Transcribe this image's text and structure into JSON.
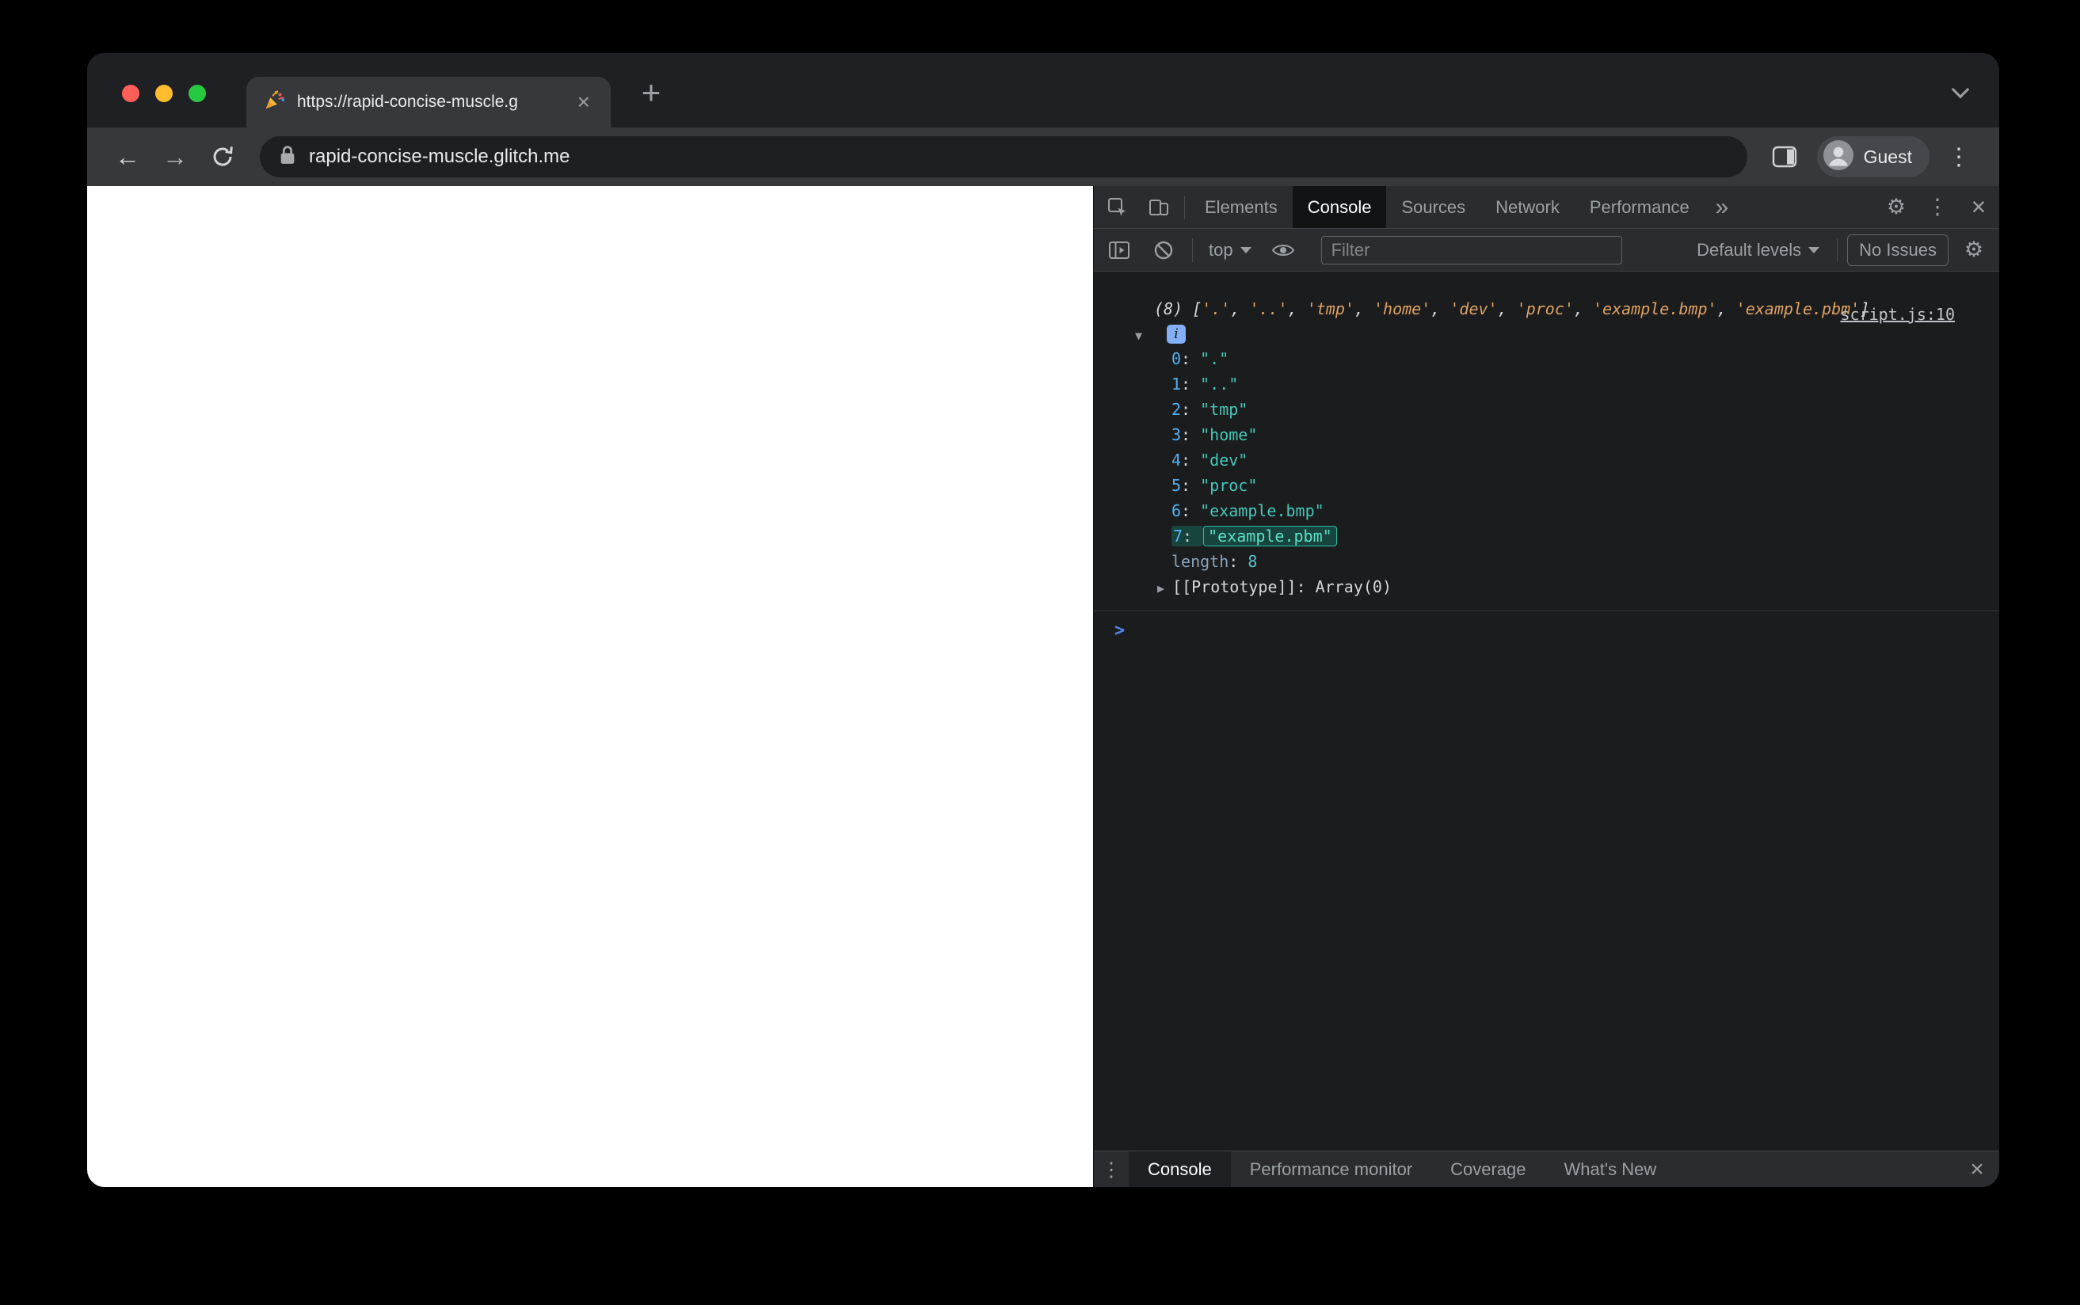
{
  "colors": {
    "frame_bg": "#1f2023",
    "toolbar_bg": "#37383c",
    "omnibox_bg": "#1e1f22",
    "guest_pill_bg": "#45474c",
    "page_bg": "#ffffff",
    "dt_toolbar_bg": "#2b2c2f",
    "dt_border": "#3c4043",
    "dt_active_tab_bg": "#121315",
    "drawer_active_bg": "#1f2023",
    "console_bg": "#1b1c1e",
    "text_primary": "#e8eaed",
    "text_secondary": "#9aa0a6",
    "traffic_red": "#ff5f57",
    "traffic_yellow": "#febc2e",
    "traffic_green": "#28c840",
    "index_color": "#55b0f0",
    "string_color": "#45c8b8",
    "preview_string_color": "#dfa263",
    "number_color": "#58c0cc",
    "length_label_color": "#8aa3b8",
    "punct_color": "#d5d7da",
    "prompt_color": "#4f87f2",
    "link_color": "#c0c4c9",
    "highlight_bg": "#17453d",
    "highlight_border": "#2abca0",
    "highlight_text": "#5ce0c8",
    "info_badge_bg": "#84aef6",
    "filter_border": "#5f6368"
  },
  "icons": {
    "back": "←",
    "forward": "→",
    "new_tab": "+",
    "tab_close": "×",
    "kebab": "⋮",
    "more_tabs": "»",
    "gear": "⚙",
    "close": "×",
    "tree_expanded": "▼",
    "tree_collapsed": "▶"
  },
  "browser": {
    "tab_title": "https://rapid-concise-muscle.g",
    "url": "rapid-concise-muscle.glitch.me",
    "profile_label": "Guest"
  },
  "devtools": {
    "tabs": [
      "Elements",
      "Console",
      "Sources",
      "Network",
      "Performance"
    ],
    "active_tab": "Console",
    "toolbar": {
      "context_label": "top",
      "filter_placeholder": "Filter",
      "levels_label": "Default levels",
      "issues_label": "No Issues"
    },
    "console": {
      "source_link": "script.js:10",
      "preview_count": "(8)",
      "preview_items": [
        ".",
        "..",
        "tmp",
        "home",
        "dev",
        "proc",
        "example.bmp",
        "example.pbm"
      ],
      "info_badge": "i",
      "entries": [
        {
          "index": "0",
          "value": "."
        },
        {
          "index": "1",
          "value": ".."
        },
        {
          "index": "2",
          "value": "tmp"
        },
        {
          "index": "3",
          "value": "home"
        },
        {
          "index": "4",
          "value": "dev"
        },
        {
          "index": "5",
          "value": "proc"
        },
        {
          "index": "6",
          "value": "example.bmp"
        },
        {
          "index": "7",
          "value": "example.pbm",
          "highlighted": true
        }
      ],
      "length_label": "length",
      "length_value": "8",
      "prototype_label": "[[Prototype]]",
      "prototype_value": "Array(0)",
      "prompt": ">"
    },
    "drawer": {
      "tabs": [
        "Console",
        "Performance monitor",
        "Coverage",
        "What's New"
      ],
      "active_tab": "Console"
    }
  }
}
